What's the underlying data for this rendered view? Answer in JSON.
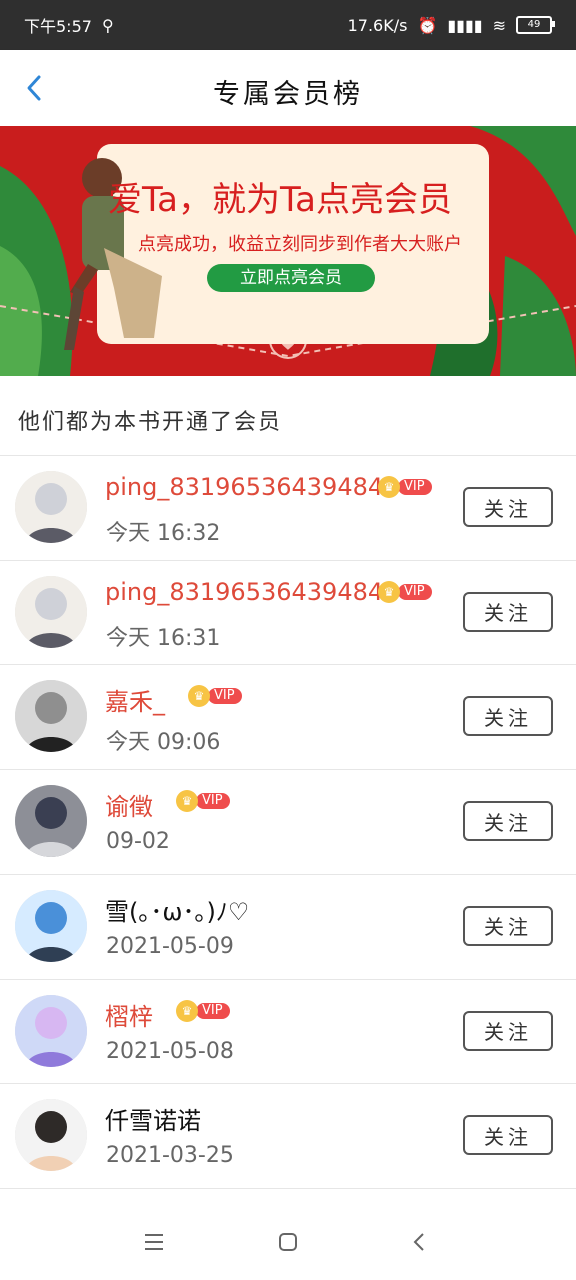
{
  "status_bar": {
    "time": "下午5:57",
    "speed": "17.6K/s",
    "battery": "49"
  },
  "header": {
    "title": "专属会员榜"
  },
  "banner": {
    "title": "爱Ta，就为Ta点亮会员",
    "subtitle": "点亮成功，收益立刻同步到作者大大账户",
    "button": "立即点亮会员"
  },
  "section": {
    "heading": "他们都为本书开通了会员"
  },
  "members": [
    {
      "name": "ping_831965364394842",
      "date": "今天 16:32",
      "vip": true,
      "name_color": "#de4a3a",
      "follow_label": "关注"
    },
    {
      "name": "ping_831965364394842",
      "date": "今天 16:31",
      "vip": true,
      "name_color": "#de4a3a",
      "follow_label": "关注"
    },
    {
      "name": "嘉禾_",
      "date": "今天 09:06",
      "vip": true,
      "name_color": "#de4a3a",
      "follow_label": "关注"
    },
    {
      "name": "谕徵",
      "date": "09-02",
      "vip": true,
      "name_color": "#de4a3a",
      "follow_label": "关注"
    },
    {
      "name": "雪(｡･ω･｡)ﾉ♡",
      "date": "2021-05-09",
      "vip": false,
      "name_color": "#111111",
      "follow_label": "关注"
    },
    {
      "name": "槢梓",
      "date": "2021-05-08",
      "vip": true,
      "name_color": "#de4a3a",
      "follow_label": "关注"
    },
    {
      "name": "仟雪诺诺",
      "date": "2021-03-25",
      "vip": false,
      "name_color": "#111111",
      "follow_label": "关注"
    }
  ],
  "vip_badge": {
    "text": "VIP"
  },
  "colors": {
    "accent_red": "#de4a3a",
    "banner_red": "#c91d1d",
    "cta_green": "#229b43",
    "back_blue": "#2f86d6"
  }
}
